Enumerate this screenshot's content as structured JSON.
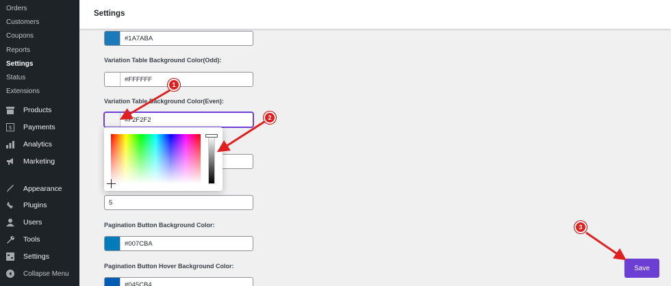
{
  "sidebar": {
    "submenu": [
      "Orders",
      "Customers",
      "Coupons",
      "Reports",
      "Settings",
      "Status",
      "Extensions"
    ],
    "current_submenu": "Settings",
    "menu": [
      {
        "label": "Products",
        "icon": "products-icon"
      },
      {
        "label": "Payments",
        "icon": "payments-icon"
      },
      {
        "label": "Analytics",
        "icon": "analytics-icon"
      },
      {
        "label": "Marketing",
        "icon": "marketing-icon"
      },
      {
        "label": "Appearance",
        "icon": "appearance-icon"
      },
      {
        "label": "Plugins",
        "icon": "plugins-icon"
      },
      {
        "label": "Users",
        "icon": "users-icon"
      },
      {
        "label": "Tools",
        "icon": "tools-icon"
      },
      {
        "label": "Settings",
        "icon": "settings-icon"
      }
    ],
    "collapse_label": "Collapse Menu"
  },
  "header": {
    "title": "Settings"
  },
  "fields": {
    "top_color": {
      "value": "#1A7ABA",
      "swatch": "#1A7ABA"
    },
    "odd": {
      "label": "Variation Table Background Color(Odd):",
      "value": "#FFFFFF",
      "swatch": "#FFFFFF"
    },
    "even": {
      "label": "Variation Table Background Color(Even):",
      "value": "#F2F2F2",
      "swatch": "#F2F2F2"
    },
    "number": {
      "value": "5"
    },
    "pagination_bg": {
      "label": "Pagination Button Background Color:",
      "value": "#007CBA",
      "swatch": "#007CBA"
    },
    "pagination_hover": {
      "label": "Pagination Button Hover Background Color:",
      "value": "#045CB4",
      "swatch": "#045CB4"
    }
  },
  "save_label": "Save",
  "annotations": [
    "1",
    "2",
    "3"
  ],
  "colors": {
    "accent": "#6B3FD4",
    "annotation": "#E02020",
    "sidebar": "#1D2327"
  }
}
